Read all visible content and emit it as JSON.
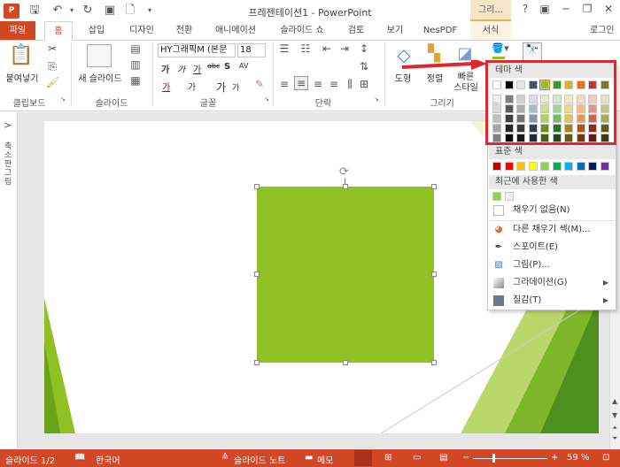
{
  "titlebar": {
    "logo": "P",
    "title": "프레젠테이션1 - PowerPoint",
    "context_tab": "그리...",
    "help": "?",
    "minimize": "─",
    "restore": "❐",
    "close": "✕"
  },
  "tabs": {
    "file": "파일",
    "home": "홈",
    "insert": "삽입",
    "design": "디자인",
    "transitions": "전환",
    "animations": "애니메이션",
    "slideshow": "슬라이드 쇼",
    "review": "검토",
    "view": "보기",
    "nespdf": "NesPDF",
    "format": "서식",
    "login": "로그인"
  },
  "ribbon": {
    "paste": "붙여넣기",
    "clipboard": "클립보드",
    "new_slide": "새 슬라이드",
    "slides": "슬라이드",
    "font_name": "HY그래픽M (본문",
    "font_size": "18",
    "font": "글꼴",
    "paragraph": "단락",
    "shapes": "도형",
    "arrange": "정렬",
    "quick_styles_1": "빠른",
    "quick_styles_2": "스타일",
    "drawing": "그리기",
    "bold": "가",
    "italic": "가",
    "underline": "가",
    "strike": "abc",
    "shadow": "S",
    "spacing": "AV",
    "case": "가",
    "grow": "가",
    "shrink": "가",
    "font_color": "가"
  },
  "left_panel": {
    "toggle": ">",
    "label": "축소판 그림"
  },
  "statusbar": {
    "slide_info": "슬라이드 1/2",
    "language": "한국어",
    "notes": "슬라이드 노트",
    "comments": "메모",
    "zoom": "59 %",
    "minus": "−",
    "plus": "+"
  },
  "dropdown": {
    "theme_colors_header": "테마 색",
    "standard_colors_header": "표준 색",
    "recent_colors_header": "최근에 사용한 색",
    "no_fill": "채우기 없음(N)",
    "more_colors": "다른 채우기 색(M)...",
    "eyedropper": "스포이트(E)",
    "picture": "그림(P)...",
    "gradient": "그라데이션(G)",
    "texture": "질감(T)"
  },
  "colors": {
    "theme_top": [
      "#ffffff",
      "#000000",
      "#e7e6e6",
      "#44546a",
      "#8fc024",
      "#3a9a2c",
      "#d8b02a",
      "#e8741c",
      "#c0392b",
      "#7a7a2a"
    ],
    "theme_shades": [
      [
        "#f2f2f2",
        "#7f7f7f",
        "#d0cece",
        "#d6dce4",
        "#e3f1c6",
        "#cfeac9",
        "#f5ebc4",
        "#fbdcc3",
        "#f2cac5",
        "#e2e2c4"
      ],
      [
        "#d9d9d9",
        "#595959",
        "#aeabab",
        "#adb9ca",
        "#c7e38e",
        "#a0d595",
        "#ecd889",
        "#f7b988",
        "#e5958c",
        "#c6c68a"
      ],
      [
        "#bfbfbf",
        "#3f3f3f",
        "#757171",
        "#8497b0",
        "#aad556",
        "#71c061",
        "#e2c44e",
        "#f3964d",
        "#d86053",
        "#aaaa4f"
      ],
      [
        "#a6a6a6",
        "#262626",
        "#3a3838",
        "#323f4f",
        "#6b901b",
        "#2b7321",
        "#a3841f",
        "#ad5715",
        "#902b20",
        "#5c5c20"
      ],
      [
        "#7f7f7f",
        "#0c0c0c",
        "#171616",
        "#222a35",
        "#476012",
        "#1d4d16",
        "#6d5815",
        "#743a0e",
        "#601d15",
        "#3d3d15"
      ]
    ],
    "standard": [
      "#c00000",
      "#ff0000",
      "#ffc000",
      "#ffff00",
      "#92d050",
      "#00b050",
      "#00b0f0",
      "#0070c0",
      "#002060",
      "#7030a0"
    ],
    "recent": [
      "#92d050",
      "#f2f2f2"
    ],
    "shape_fill": "#8fc024",
    "accent": "#d24726",
    "highlight": "#e0262f"
  }
}
